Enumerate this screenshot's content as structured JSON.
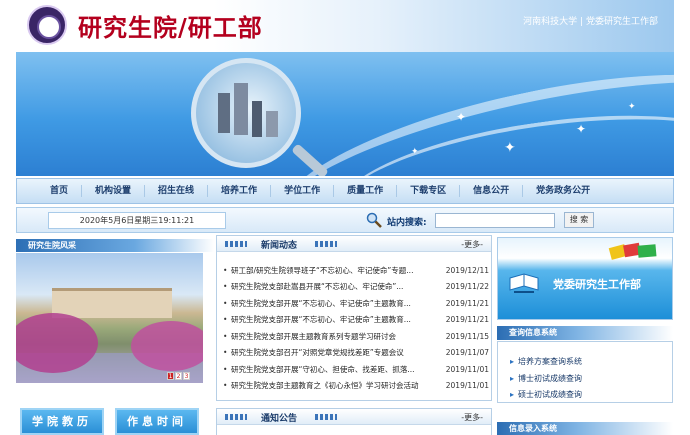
{
  "header": {
    "title": "研究生院/研工部",
    "top_link_1": "河南科技大学",
    "top_link_sep": "|",
    "top_link_2": "党委研究生工作部"
  },
  "nav": {
    "items": [
      "首页",
      "机构设置",
      "招生在线",
      "培养工作",
      "学位工作",
      "质量工作",
      "下载专区",
      "信息公开",
      "党务政务公开"
    ]
  },
  "toolbar": {
    "datetime": "2020年5月6日星期三19:11:21",
    "search_label": "站内搜索:",
    "search_button": "搜 索"
  },
  "left": {
    "title": "研究生院风采",
    "pager": [
      "1",
      "2",
      "3"
    ],
    "quick_1": "学院教历",
    "quick_2": "作息时间"
  },
  "news": {
    "title": "新闻动态",
    "more": "-更多-",
    "items": [
      {
        "title": "研工部/研究生院领导班子“不忘初心、牢记使命”专题...",
        "date": "2019/12/11"
      },
      {
        "title": "研究生院党支部赴嵩县开展“不忘初心、牢记使命”...",
        "date": "2019/11/22"
      },
      {
        "title": "研究生院党支部开展“不忘初心、牢记使命”主题教育...",
        "date": "2019/11/21"
      },
      {
        "title": "研究生院党支部开展“不忘初心、牢记使命”主题教育...",
        "date": "2019/11/21"
      },
      {
        "title": "研究生院党支部开展主题教育系列专题学习研讨会",
        "date": "2019/11/15"
      },
      {
        "title": "研究生院党支部召开“对照党章党规找差距”专题会议",
        "date": "2019/11/07"
      },
      {
        "title": "研究生院党支部开展“守初心、担使命、找差距、抓落...",
        "date": "2019/11/01"
      },
      {
        "title": "研究生院党支部主题教育之《初心永恒》学习研讨会活动",
        "date": "2019/11/01"
      }
    ]
  },
  "notice": {
    "title": "通知公告",
    "more": "-更多-"
  },
  "right": {
    "party_label": "党委研究生工作部",
    "query_title": "查询信息系统",
    "query_items": [
      "培养方案查询系统",
      "博士初试成绩查询",
      "硕士初试成绩查询"
    ],
    "entry_title": "信息录入系统"
  },
  "colors": {
    "brand_red": "#b4001e",
    "nav_text": "#1e3f6e",
    "accent_blue": "#2c7fd2"
  }
}
